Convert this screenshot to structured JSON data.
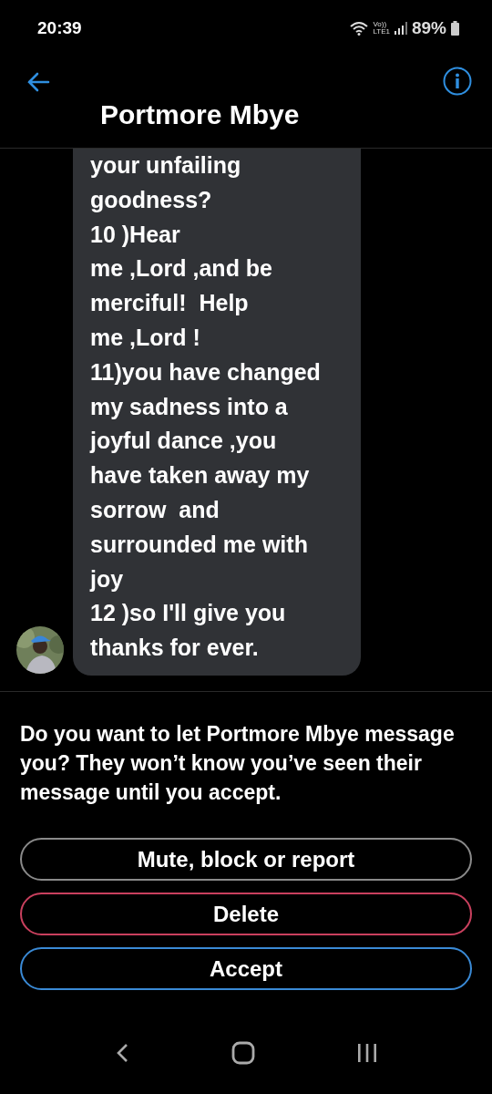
{
  "status_bar": {
    "time": "20:39",
    "network_top": "Vo))",
    "network_bottom": "LTE1",
    "battery": "89%"
  },
  "header": {
    "title": "Portmore Mbye"
  },
  "message": {
    "text": "your unfailing\ngoodness?\n10 )Hear\nme ,Lord ,and be\nmerciful!  Help\nme ,Lord !\n11)you have changed\nmy sadness into a\njoyful dance ,you\nhave taken away my\nsorrow  and\nsurrounded me with\njoy\n12 )so I'll give you\nthanks for ever."
  },
  "request": {
    "prompt": "Do you want to let Portmore Mbye message you? They won’t know you’ve seen their message until you accept.",
    "buttons": [
      {
        "label": "Mute, block or report",
        "color": "#8a8a8a"
      },
      {
        "label": "Delete",
        "color": "#c9405e"
      },
      {
        "label": "Accept",
        "color": "#3a8ad6"
      }
    ]
  }
}
